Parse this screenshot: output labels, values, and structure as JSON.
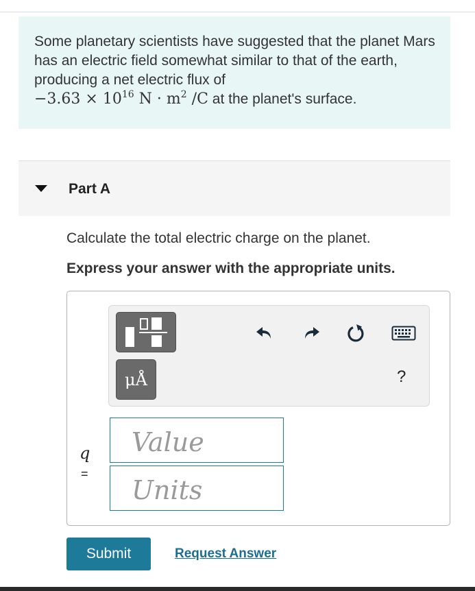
{
  "problem": {
    "text": "Some planetary scientists have suggested that the planet Mars has an electric field somewhat similar to that of the earth, producing a net electric flux of",
    "flux_coefficient": "−3.63 × 10",
    "flux_exponent": "16",
    "flux_units_main": " N · m",
    "flux_units_power": "2",
    "flux_units_tail": " /C",
    "suffix": " at the planet's surface."
  },
  "part": {
    "title": "Part A",
    "question": "Calculate the total electric charge on the planet.",
    "instruction": "Express your answer with the appropriate units."
  },
  "toolbar": {
    "units_button_label": "μÅ",
    "help_label": "?",
    "icons": [
      "fraction-template-icon",
      "undo-icon",
      "redo-icon",
      "reset-icon",
      "keyboard-icon"
    ]
  },
  "answer": {
    "variable": "q",
    "equals": "=",
    "value_placeholder": "Value",
    "units_placeholder": "Units"
  },
  "actions": {
    "submit_label": "Submit",
    "request_label": "Request Answer"
  },
  "colors": {
    "problem_bg": "#e8f6f6",
    "accent": "#1e7a99",
    "link": "#1b6e8f"
  }
}
